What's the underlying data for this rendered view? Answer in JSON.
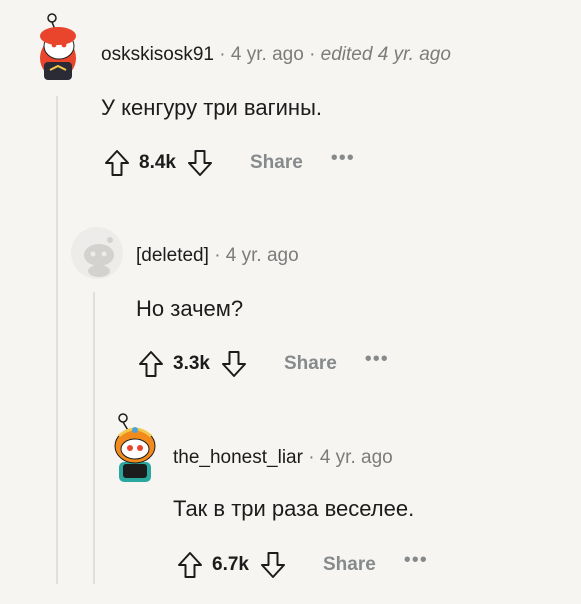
{
  "comments": [
    {
      "author": "oskskisosk91",
      "time": "4 yr. ago",
      "edited": "edited 4 yr. ago",
      "body": "У кенгуру три вагины.",
      "score": "8.4k",
      "share_label": "Share",
      "avatar": "snoo-avatar-red-hoodie"
    },
    {
      "author": "[deleted]",
      "time": "4 yr. ago",
      "body": "Но зачем?",
      "score": "3.3k",
      "share_label": "Share",
      "avatar": "deleted-user-avatar"
    },
    {
      "author": "the_honest_liar",
      "time": "4 yr. ago",
      "body": "Так в три раза веселее.",
      "score": "6.7k",
      "share_label": "Share",
      "avatar": "snoo-avatar-orange-helmet"
    }
  ],
  "separator": "·",
  "more_label": "•••",
  "colors": {
    "background": "#f6f5f2",
    "thread_line": "#e0dfdb",
    "muted_text": "#7c7c7c",
    "share_text": "#878a8c",
    "avatar_red": "#e9442c",
    "avatar_orange": "#f28a1e"
  }
}
